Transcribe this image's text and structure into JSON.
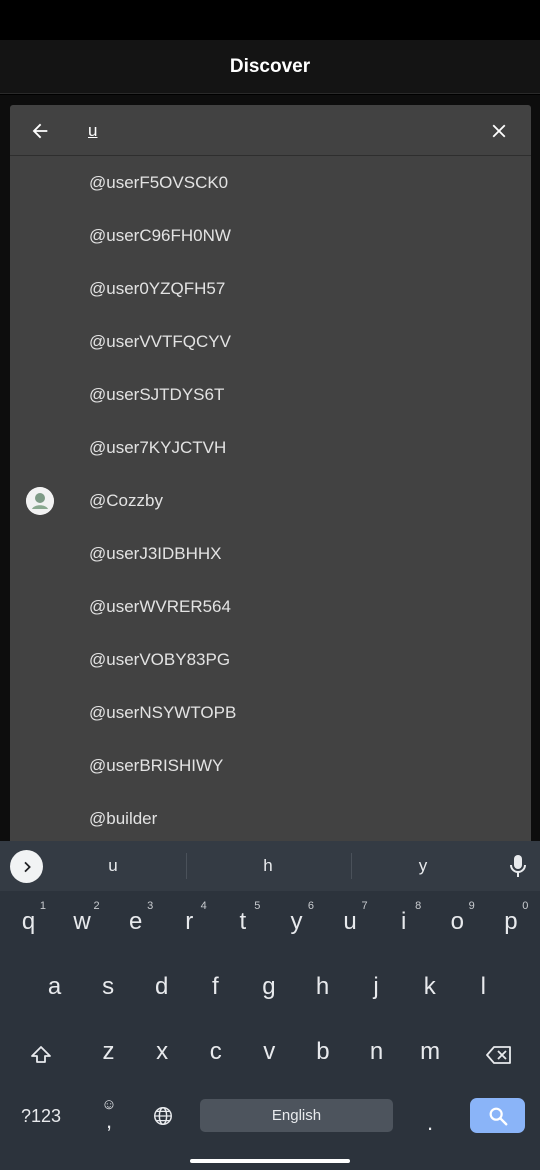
{
  "header": {
    "title": "Discover"
  },
  "search": {
    "query": "u"
  },
  "results": [
    {
      "label": "@userF5OVSCK0",
      "has_avatar": false
    },
    {
      "label": "@userC96FH0NW",
      "has_avatar": false
    },
    {
      "label": "@user0YZQFH57",
      "has_avatar": false
    },
    {
      "label": "@userVVTFQCYV",
      "has_avatar": false
    },
    {
      "label": "@userSJTDYS6T",
      "has_avatar": false
    },
    {
      "label": "@user7KYJCTVH",
      "has_avatar": false
    },
    {
      "label": "@Cozzby",
      "has_avatar": true
    },
    {
      "label": "@userJ3IDBHHX",
      "has_avatar": false
    },
    {
      "label": "@userWVRER564",
      "has_avatar": false
    },
    {
      "label": "@userVOBY83PG",
      "has_avatar": false
    },
    {
      "label": "@userNSYWTOPB",
      "has_avatar": false
    },
    {
      "label": "@userBRISHIWY",
      "has_avatar": false
    },
    {
      "label": "@builder",
      "has_avatar": false
    }
  ],
  "keyboard": {
    "suggestions": [
      "u",
      "h",
      "y"
    ],
    "row1": [
      {
        "key": "q",
        "hint": "1"
      },
      {
        "key": "w",
        "hint": "2"
      },
      {
        "key": "e",
        "hint": "3"
      },
      {
        "key": "r",
        "hint": "4"
      },
      {
        "key": "t",
        "hint": "5"
      },
      {
        "key": "y",
        "hint": "6"
      },
      {
        "key": "u",
        "hint": "7"
      },
      {
        "key": "i",
        "hint": "8"
      },
      {
        "key": "o",
        "hint": "9"
      },
      {
        "key": "p",
        "hint": "0"
      }
    ],
    "row2": [
      "a",
      "s",
      "d",
      "f",
      "g",
      "h",
      "j",
      "k",
      "l"
    ],
    "row3": [
      "z",
      "x",
      "c",
      "v",
      "b",
      "n",
      "m"
    ],
    "symbols_label": "?123",
    "comma": ",",
    "period": ".",
    "space_label": "English"
  },
  "colors": {
    "panel": "#424242",
    "keyboard": "#2c333c",
    "accent": "#8ab4f8"
  }
}
